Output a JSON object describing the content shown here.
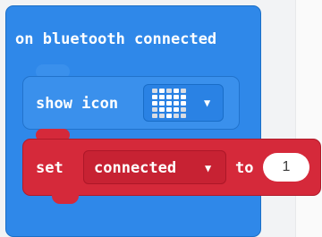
{
  "event_block": {
    "label": "on bluetooth connected",
    "color": "#2f88e9"
  },
  "show_icon_block": {
    "label": "show icon",
    "icon": "heart-icon",
    "heart_pattern": [
      [
        0,
        1,
        0,
        1,
        0
      ],
      [
        1,
        1,
        1,
        1,
        1
      ],
      [
        1,
        1,
        1,
        1,
        1
      ],
      [
        0,
        1,
        1,
        1,
        0
      ],
      [
        0,
        0,
        1,
        0,
        0
      ]
    ],
    "dropdown_caret": "▼"
  },
  "set_block": {
    "label": "set",
    "variable": "connected",
    "dropdown_caret": "▼",
    "to_label": "to",
    "value": "1",
    "color": "#d5293a"
  }
}
